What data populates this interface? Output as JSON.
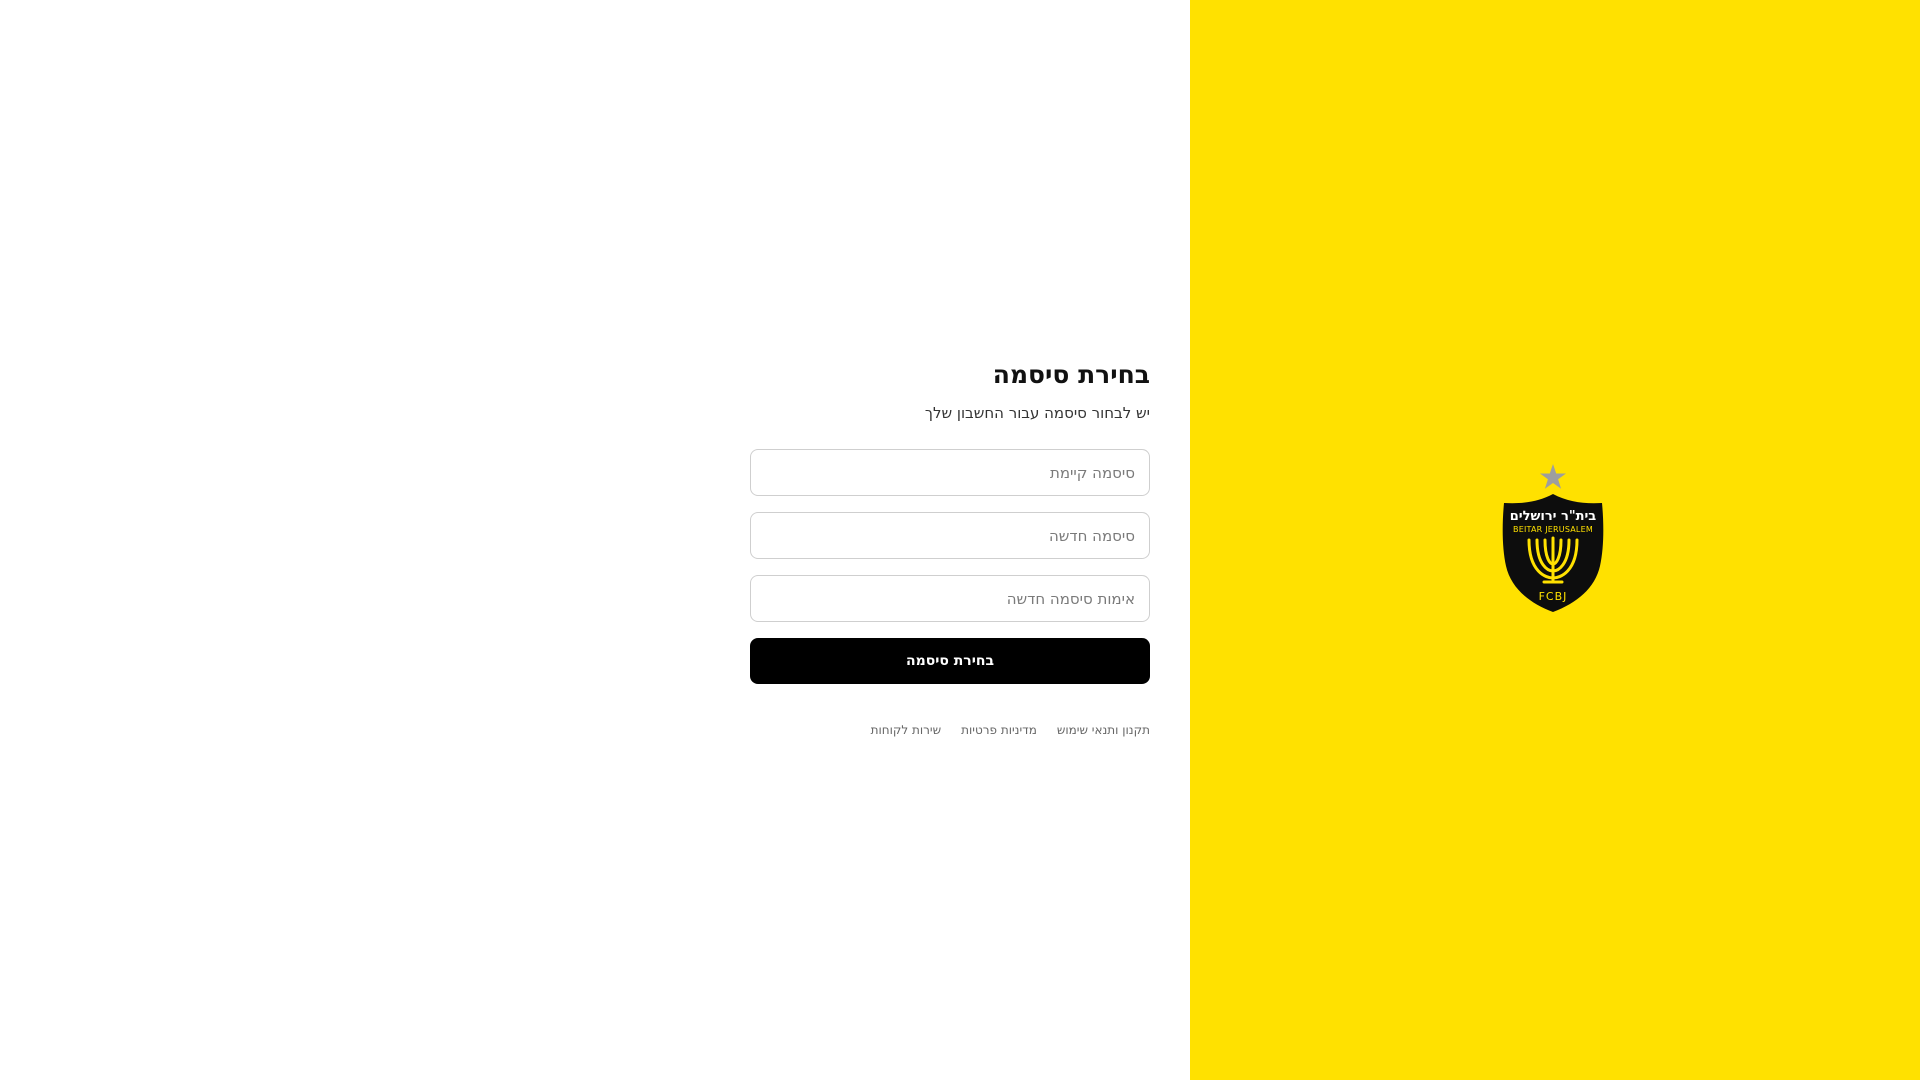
{
  "form": {
    "title": "בחירת סיסמה",
    "subtitle": "יש לבחור סיסמה עבור החשבון שלך",
    "current_password_placeholder": "סיסמה קיימת",
    "new_password_placeholder": "סיסמה חדשה",
    "confirm_password_placeholder": "אימות סיסמה חדשה",
    "submit_label": "בחירת סיסמה"
  },
  "footer": {
    "links": [
      {
        "label": "תקנון ותנאי שימוש"
      },
      {
        "label": "מדיניות פרטיות"
      },
      {
        "label": "שירות לקוחות"
      }
    ]
  },
  "logo": {
    "hebrew_text": "בית\"ר ירושלים",
    "english_text": "BEITAR JERUSALEM",
    "monogram": "FCBJ",
    "icon": "menorah-crest-icon"
  },
  "colors": {
    "brand_yellow": "#ffe100",
    "button_black": "#000000",
    "crest_star": "#9e9e9e"
  }
}
